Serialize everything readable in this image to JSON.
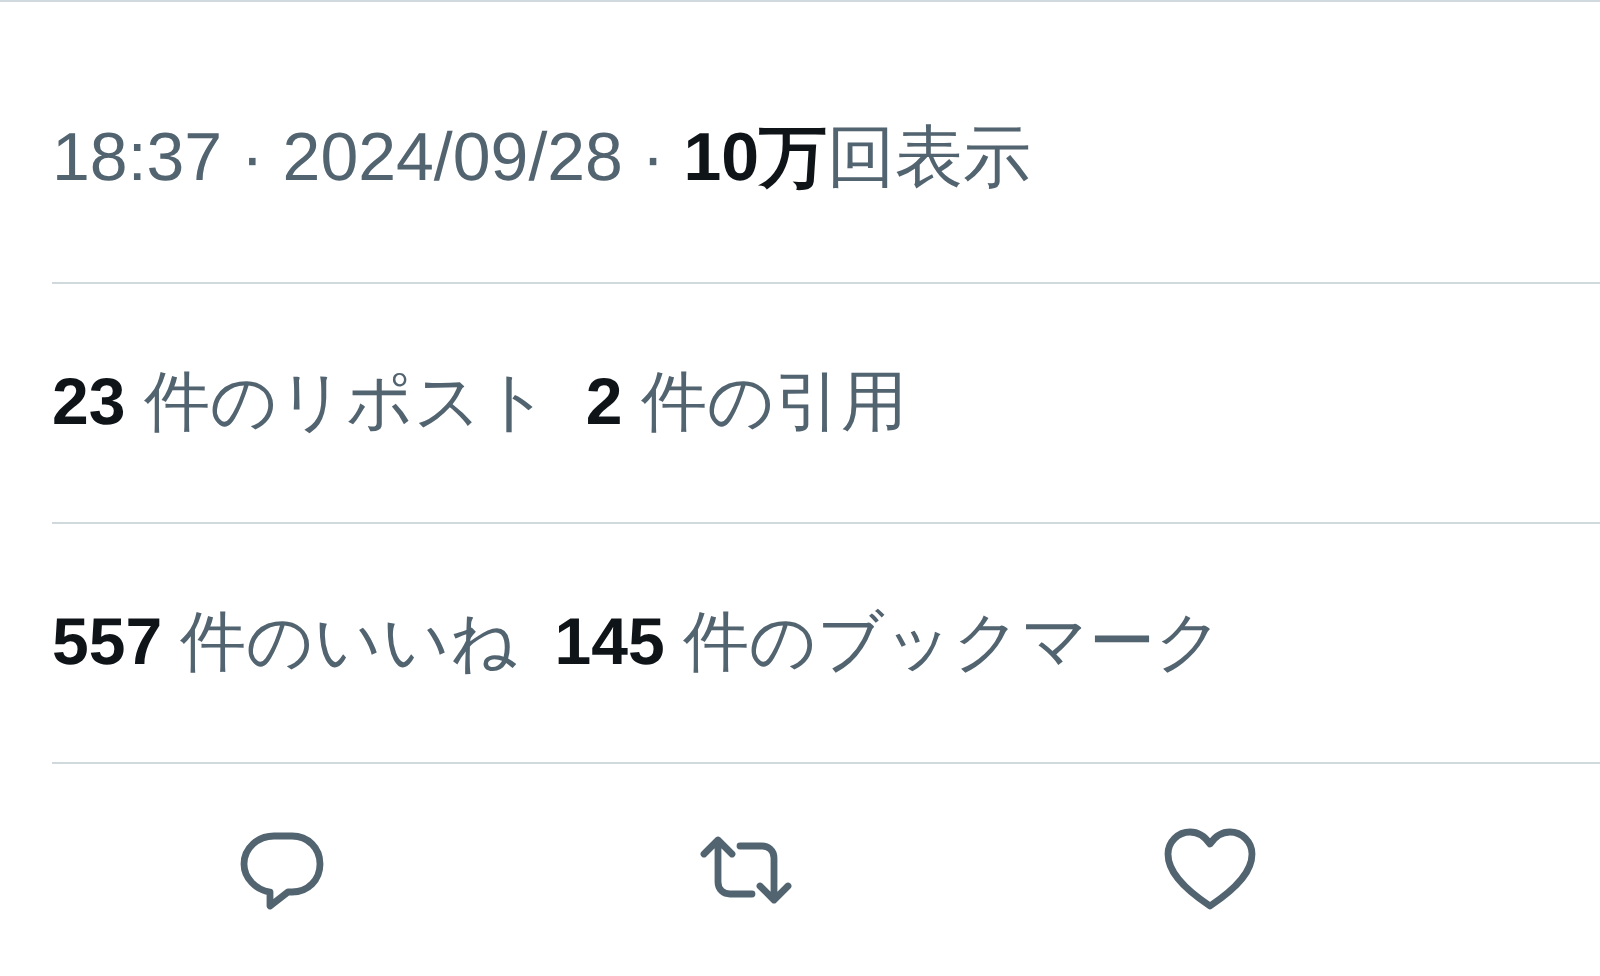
{
  "meta": {
    "text": "18:37 · 2024/09/28 · **10万**回表示"
  },
  "stats_rows": [
    {
      "items": [
        {
          "text": "**23** 件のリポスト"
        },
        {
          "text": "**2** 件の引用"
        }
      ]
    },
    {
      "items": [
        {
          "text": "**557** 件のいいね"
        },
        {
          "text": "**145** 件のブックマーク"
        }
      ]
    }
  ],
  "actions": [
    {
      "kind": "reply"
    },
    {
      "kind": "repost"
    },
    {
      "kind": "like"
    }
  ]
}
